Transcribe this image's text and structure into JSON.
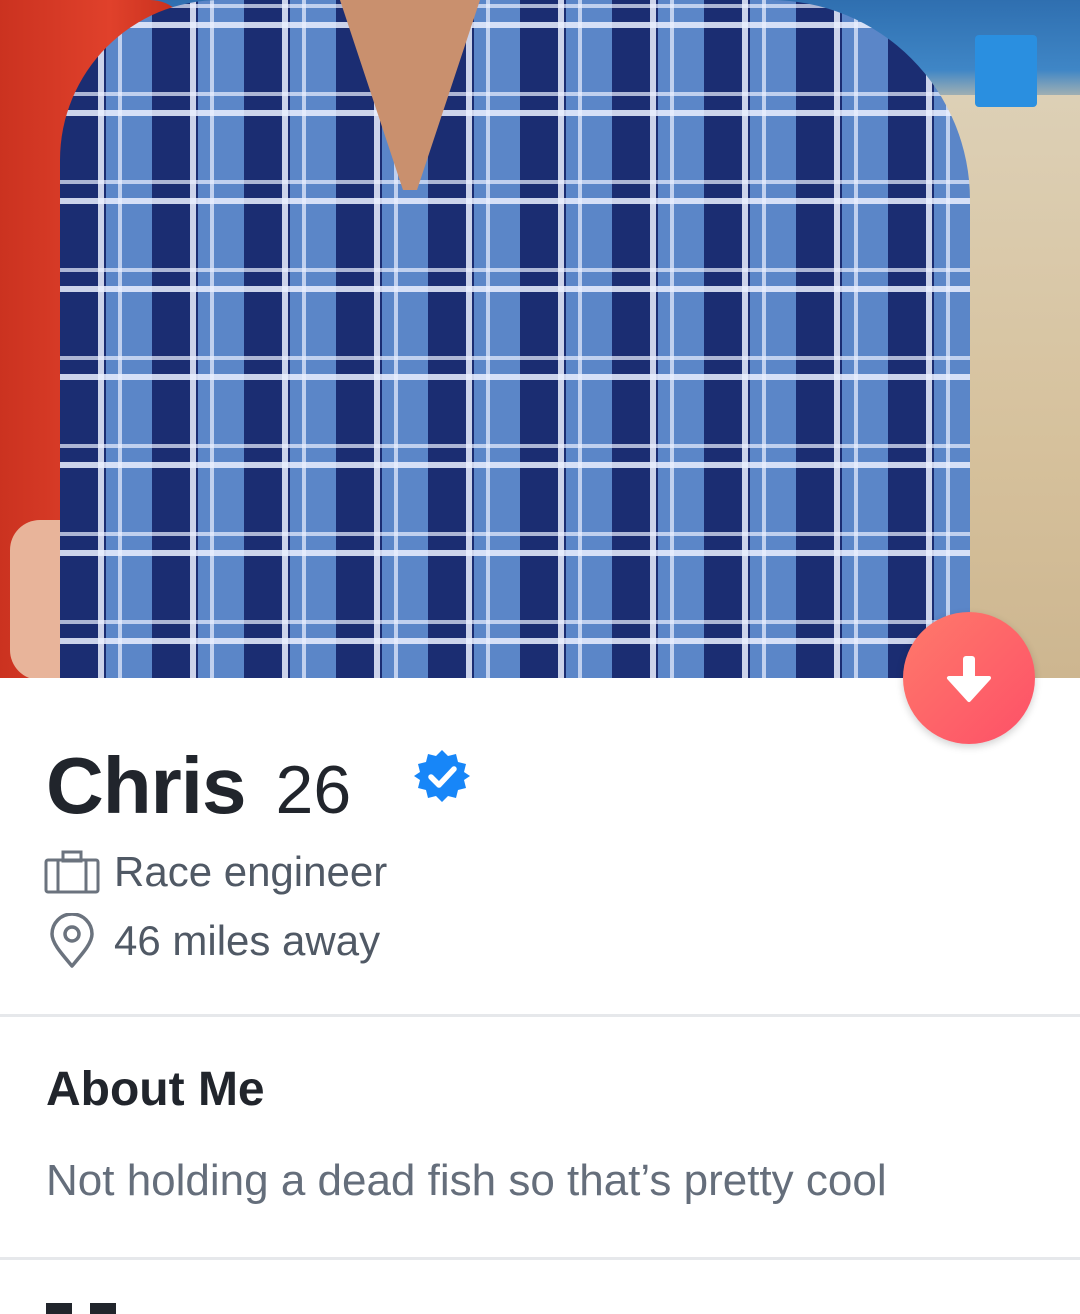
{
  "profile": {
    "name": "Chris",
    "age": "26",
    "verified_icon": "verified-badge-icon",
    "job": "Race engineer",
    "distance": "46 miles away"
  },
  "about": {
    "title": "About Me",
    "text": "Not holding a dead fish so that’s pretty cool"
  },
  "colors": {
    "accent": "#fd5068",
    "verified": "#1786f8",
    "text_dark": "#21252c",
    "text_muted": "#505965"
  },
  "icons": {
    "job": "briefcase-icon",
    "distance": "location-pin-icon",
    "collapse": "arrow-down-icon"
  }
}
